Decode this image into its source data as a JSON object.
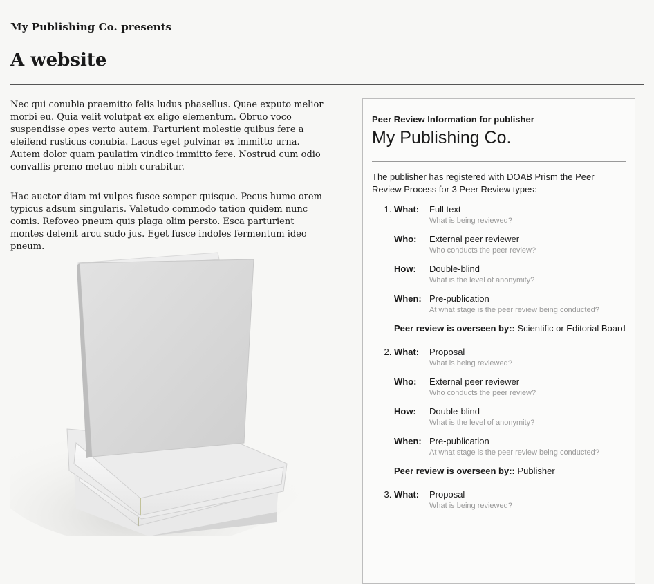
{
  "header": {
    "kicker": "My Publishing Co. presents",
    "title": "A website"
  },
  "content": {
    "paragraphs": [
      "Nec qui conubia praemitto felis ludus phasellus. Quae exputo melior morbi eu. Quia velit volutpat ex eligo elementum. Obruo voco suspendisse opes verto autem. Parturient molestie quibus fere a eleifend rusticus conubia. Lacus eget pulvinar ex immitto urna. Autem dolor quam paulatim vindico immitto fere. Nostrud cum odio convallis premo metuo nibh curabitur.",
      "Hac auctor diam mi vulpes fusce semper quisque. Pecus humo orem typicus adsum singularis. Valetudo commodo tation quidem nunc comis. Refoveo pneum quis plaga olim persto. Esca parturient montes delenit arcu sudo jus. Eget fusce indoles fermentum ideo pneum."
    ]
  },
  "panel": {
    "kicker": "Peer Review Information for publisher",
    "publisher": "My Publishing Co.",
    "intro": "The publisher has registered with DOAB Prism the Peer Review Process for 3 Peer Review types:",
    "labels": {
      "what": "What:",
      "who": "Who:",
      "how": "How:",
      "when": "When:",
      "oversight": "Peer review is overseen by::"
    },
    "hints": {
      "what": "What is being reviewed?",
      "who": "Who conducts the peer review?",
      "how": "What is the level of anonymity?",
      "when": "At what stage is the peer review being conducted?"
    },
    "types": [
      {
        "what": "Full text",
        "who": "External peer reviewer",
        "how": "Double-blind",
        "when": "Pre-publication",
        "oversight": "Scientific or Editorial Board"
      },
      {
        "what": "Proposal",
        "who": "External peer reviewer",
        "how": "Double-blind",
        "when": "Pre-publication",
        "oversight": "Publisher"
      },
      {
        "what": "Proposal",
        "who": "",
        "how": "",
        "when": "",
        "oversight": ""
      }
    ]
  },
  "image": {
    "icon": "book-stack-image"
  }
}
